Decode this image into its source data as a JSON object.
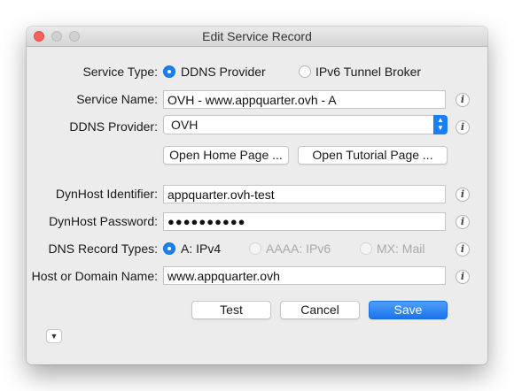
{
  "window": {
    "title": "Edit Service Record"
  },
  "service_type": {
    "label": "Service Type:",
    "options": [
      {
        "label": "DDNS Provider",
        "selected": true
      },
      {
        "label": "IPv6 Tunnel Broker",
        "selected": false
      }
    ]
  },
  "service_name": {
    "label": "Service Name:",
    "value": "OVH - www.appquarter.ovh - A"
  },
  "ddns_provider": {
    "label": "DDNS Provider:",
    "value": "OVH"
  },
  "buttons": {
    "home_page": "Open Home Page ...",
    "tutorial_page": "Open Tutorial Page ...",
    "test": "Test",
    "cancel": "Cancel",
    "save": "Save"
  },
  "dynhost_identifier": {
    "label": "DynHost Identifier:",
    "value": "appquarter.ovh-test"
  },
  "dynhost_password": {
    "label": "DynHost Password:",
    "value": "●●●●●●●●●●"
  },
  "dns_record_types": {
    "label": "DNS Record Types:",
    "options": [
      {
        "label": "A: IPv4",
        "selected": true,
        "enabled": true
      },
      {
        "label": "AAAA: IPv6",
        "selected": false,
        "enabled": false
      },
      {
        "label": "MX: Mail",
        "selected": false,
        "enabled": false
      }
    ]
  },
  "host_or_domain": {
    "label": "Host or Domain Name:",
    "value": "www.appquarter.ovh"
  },
  "info_glyph": "i",
  "colors": {
    "accent": "#1a7ff3",
    "close": "#fc605b",
    "window_bg": "#ececec"
  }
}
